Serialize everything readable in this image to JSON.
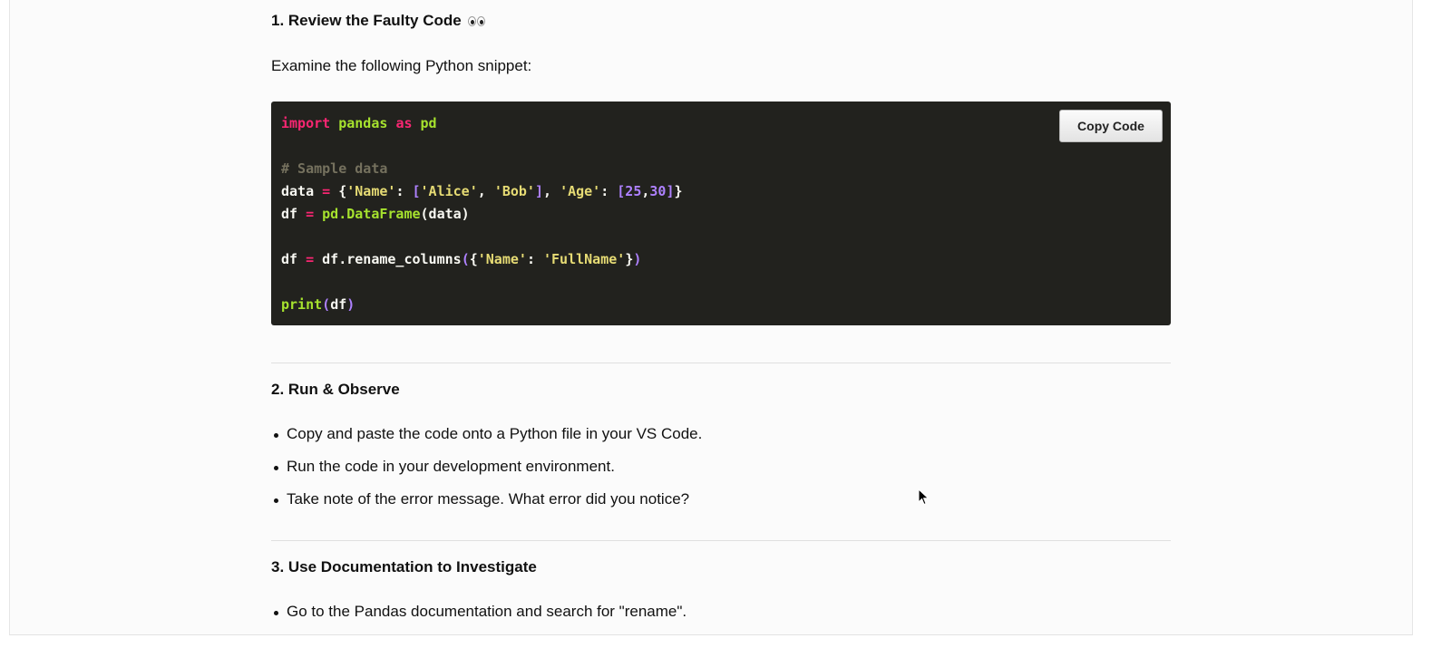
{
  "section1": {
    "title": "1. Review the Faulty Code",
    "emoji": "eyes-emoji",
    "intro": "Examine the following Python snippet:"
  },
  "code": {
    "copy_label": "Copy Code",
    "lines": [
      "import pandas as pd",
      "",
      "# Sample data",
      "data = {'Name': ['Alice', 'Bob'], 'Age': [25,30]}",
      "df = pd.DataFrame(data)",
      "",
      "df = df.rename_columns({'Name': 'FullName'})",
      "",
      "print(df)"
    ]
  },
  "section2": {
    "title": "2. Run & Observe",
    "items": [
      "Copy and paste the code onto a Python file in your VS Code.",
      "Run the code in your development environment.",
      "Take note of the error message. What error did you notice?"
    ]
  },
  "section3": {
    "title": "3. Use Documentation to Investigate",
    "items": [
      "Go to the Pandas documentation and search for \"rename\"."
    ]
  },
  "colors": {
    "code_bg": "#22221e",
    "keyword": "#f92672",
    "function": "#a6e22e",
    "string": "#e6db74",
    "number": "#ae81ff",
    "comment": "#75715e"
  }
}
